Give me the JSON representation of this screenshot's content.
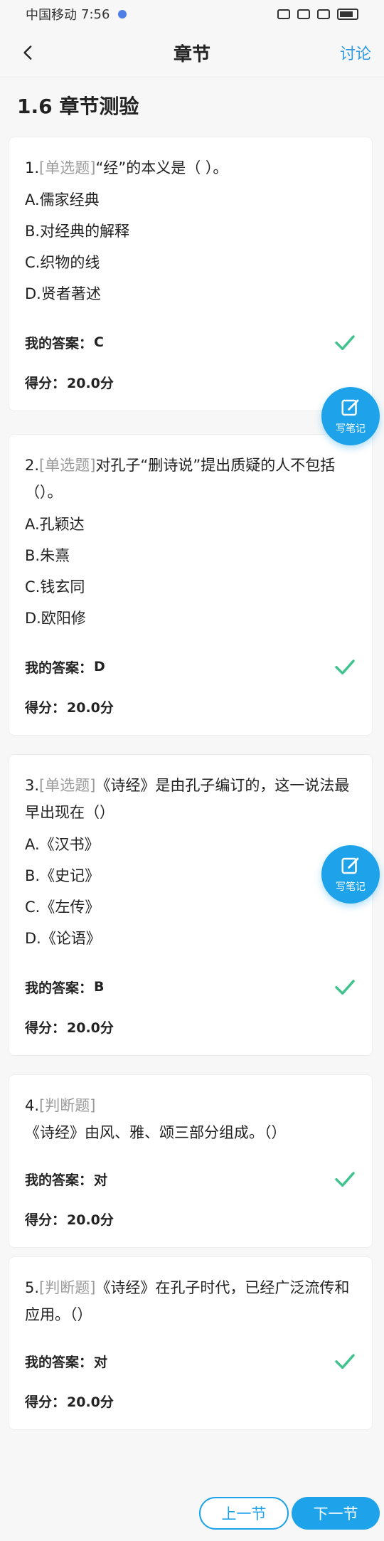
{
  "status_bar": {
    "carrier": "中国移动",
    "time": "7:56"
  },
  "header": {
    "title": "章节",
    "action": "讨论"
  },
  "section_title": "1.6 章节测验",
  "labels": {
    "my_answer": "我的答案：",
    "score": "得分：",
    "note": "写笔记",
    "prev": "上一节",
    "next": "下一节"
  },
  "questions": [
    {
      "num": "1.",
      "type": "[单选题]",
      "text": "“经”的本义是（ ）。",
      "options": [
        "A.儒家经典",
        "B.对经典的解释",
        "C.织物的线",
        "D.贤者著述"
      ],
      "answer": "C",
      "score": "20.0分"
    },
    {
      "num": "2.",
      "type": "[单选题]",
      "text": "对孔子“删诗说”提出质疑的人不包括（）。",
      "options": [
        "A.孔颖达",
        "B.朱熹",
        "C.钱玄同",
        "D.欧阳修"
      ],
      "answer": "D",
      "score": "20.0分"
    },
    {
      "num": "3.",
      "type": "[单选题]",
      "text": "《诗经》是由孔子编订的，这一说法最早出现在（）",
      "options": [
        "A.《汉书》",
        "B.《史记》",
        "C.《左传》",
        "D.《论语》"
      ],
      "answer": "B",
      "score": "20.0分"
    },
    {
      "num": "4.",
      "type": "[判断题]",
      "text": "《诗经》由风、雅、颂三部分组成。（）",
      "options": [],
      "answer": "对",
      "score": "20.0分"
    },
    {
      "num": "5.",
      "type": "[判断题]",
      "text": "《诗经》在孔子时代，已经广泛流传和应用。（）",
      "options": [],
      "answer": "对",
      "score": "20.0分"
    }
  ],
  "colors": {
    "accent": "#1ea3ea",
    "check": "#3fc38c",
    "type_gray": "#9b9b9b"
  }
}
